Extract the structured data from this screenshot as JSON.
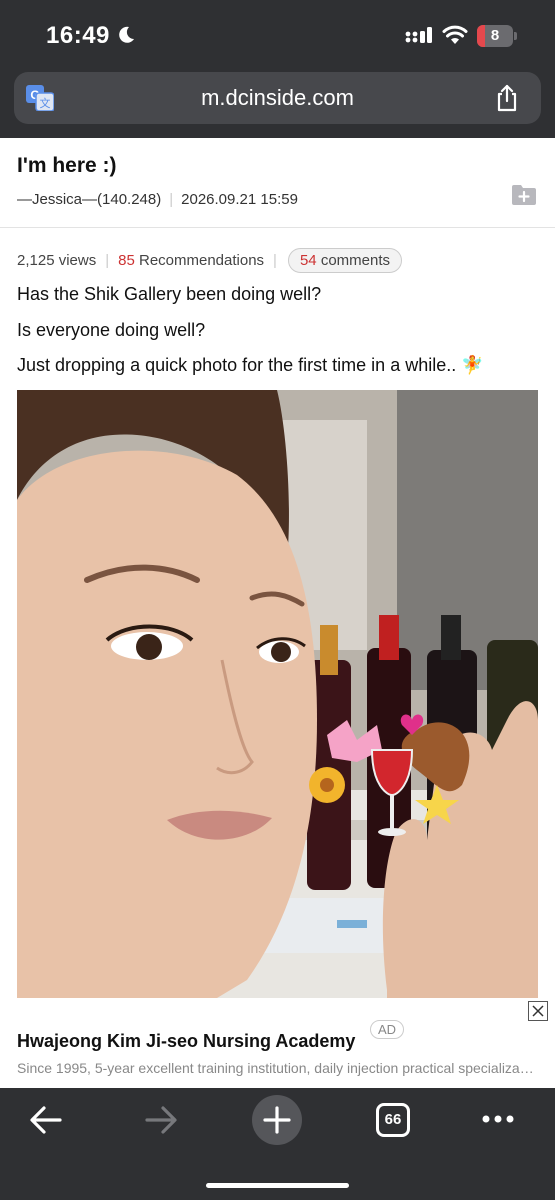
{
  "status_bar": {
    "time": "16:49",
    "battery_level": "8"
  },
  "browser": {
    "url": "m.dcinside.com",
    "tab_count": "66"
  },
  "post": {
    "title": "I'm here :)",
    "author": "—Jessica—(140.248)",
    "date": "2026.09.21 15:59",
    "views": "2,125 views",
    "recommendations_count": "85",
    "recommendations_label": "Recommendations",
    "comments_count": "54",
    "comments_label": "comments",
    "body": [
      "Has the Shik Gallery been doing well?",
      "Is everyone doing well?",
      "Just dropping a quick photo for the first time in a while.. 🧚"
    ]
  },
  "ad": {
    "title": "Hwajeong Kim Ji-seo Nursing Academy",
    "badge": "AD",
    "description": "Since 1995, 5-year excellent training institution, daily injection practical specialization"
  },
  "colors": {
    "chrome": "#2f3033",
    "accent_red": "#cc3333"
  },
  "icons": [
    "moon-icon",
    "signal-icon",
    "wifi-icon",
    "translate-icon",
    "share-icon",
    "folder-add-icon",
    "close-icon",
    "back-arrow-icon",
    "forward-arrow-icon",
    "new-tab-icon",
    "more-icon"
  ]
}
